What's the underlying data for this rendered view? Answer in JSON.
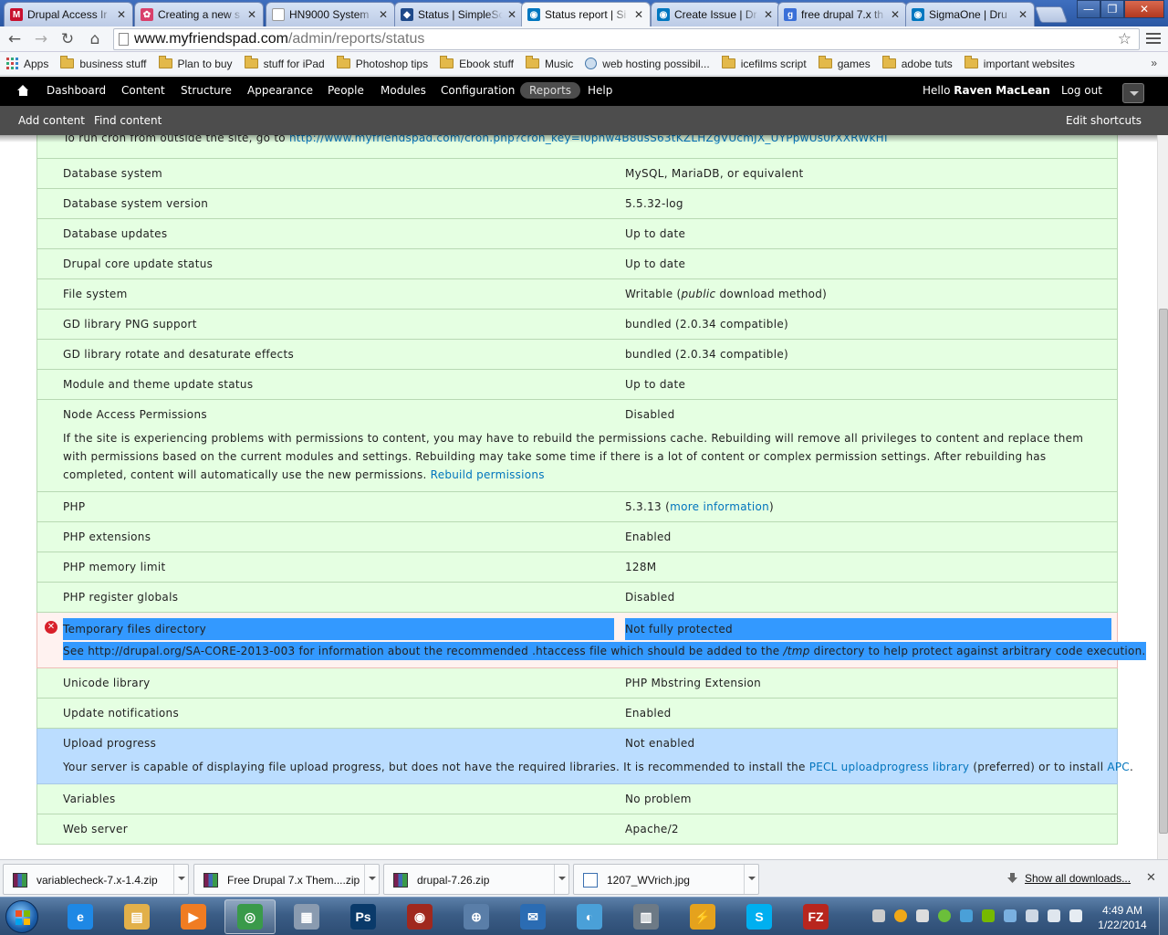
{
  "browser": {
    "tabs": [
      {
        "title": "Drupal Access Ir",
        "color": "#c8102e",
        "glyph": "M"
      },
      {
        "title": "Creating a new s",
        "color": "#d9406b",
        "glyph": "✿"
      },
      {
        "title": "HN9000 System",
        "color": "#ffffff",
        "glyph": ""
      },
      {
        "title": "Status | SimpleSc",
        "color": "#1f4a8a",
        "glyph": "◆"
      },
      {
        "title": "Status report | Si",
        "color": "#0077c0",
        "glyph": "◉",
        "active": true
      },
      {
        "title": "Create Issue | Dr",
        "color": "#0077c0",
        "glyph": "◉"
      },
      {
        "title": "free drupal 7.x th",
        "color": "#3a6fd8",
        "glyph": "g"
      },
      {
        "title": "SigmaOne | Dru",
        "color": "#0077c0",
        "glyph": "◉"
      }
    ],
    "url": {
      "host": "www.myfriendspad.com",
      "path": "/admin/reports/status"
    },
    "bookmarks": [
      {
        "label": "Apps",
        "type": "apps"
      },
      {
        "label": "business stuff",
        "type": "folder"
      },
      {
        "label": "Plan to buy",
        "type": "folder"
      },
      {
        "label": "stuff for iPad",
        "type": "folder"
      },
      {
        "label": "Photoshop tips",
        "type": "folder"
      },
      {
        "label": "Ebook stuff",
        "type": "folder"
      },
      {
        "label": "Music",
        "type": "folder"
      },
      {
        "label": "web hosting possibil...",
        "type": "page"
      },
      {
        "label": "icefilms script",
        "type": "folder"
      },
      {
        "label": "games",
        "type": "folder"
      },
      {
        "label": "adobe tuts",
        "type": "folder"
      },
      {
        "label": "important websites",
        "type": "folder"
      }
    ],
    "bookmarks_more": "»"
  },
  "drupal_toolbar": {
    "menu": [
      "Dashboard",
      "Content",
      "Structure",
      "Appearance",
      "People",
      "Modules",
      "Configuration",
      "Reports",
      "Help"
    ],
    "active": "Reports",
    "hello_prefix": "Hello",
    "user": "Raven MacLean",
    "logout": "Log out",
    "shortcuts": [
      "Add content",
      "Find content"
    ],
    "edit_shortcuts": "Edit shortcuts"
  },
  "status_report": {
    "cron_row": {
      "text": "To run cron from outside the site, go to ",
      "link": "http://www.myfriendspad.com/cron.php?cron_key=I0phw4B8usS63tKZLHZgVUcmJX_UYPpwUs0rXXRWkHI"
    },
    "rows": [
      {
        "title": "Database system",
        "value": "MySQL, MariaDB, or equivalent",
        "severity": "ok"
      },
      {
        "title": "Database system version",
        "value": "5.5.32-log",
        "severity": "ok"
      },
      {
        "title": "Database updates",
        "value": "Up to date",
        "severity": "ok"
      },
      {
        "title": "Drupal core update status",
        "value": "Up to date",
        "severity": "ok",
        "value_link": true
      },
      {
        "title": "File system",
        "value_pre": "Writable (",
        "value_em": "public",
        "value_post": " download method)",
        "severity": "ok"
      },
      {
        "title": "GD library PNG support",
        "value": "bundled (2.0.34 compatible)",
        "severity": "ok"
      },
      {
        "title": "GD library rotate and desaturate effects",
        "value": "bundled (2.0.34 compatible)",
        "severity": "ok"
      },
      {
        "title": "Module and theme update status",
        "value": "Up to date",
        "severity": "ok",
        "value_link": true
      },
      {
        "title": "Node Access Permissions",
        "value": "Disabled",
        "severity": "ok",
        "description": "If the site is experiencing problems with permissions to content, you may have to rebuild the permissions cache. Rebuilding will remove all privileges to content and replace them with permissions based on the current modules and settings. Rebuilding may take some time if there is a lot of content or complex permission settings. After rebuilding has completed, content will automatically use the new permissions. ",
        "description_link": "Rebuild permissions"
      },
      {
        "title": "PHP",
        "value_pre": "5.3.13 (",
        "value_link_text": "more information",
        "value_post": ")",
        "severity": "ok"
      },
      {
        "title": "PHP extensions",
        "value": "Enabled",
        "severity": "ok"
      },
      {
        "title": "PHP memory limit",
        "value": "128M",
        "severity": "ok"
      },
      {
        "title": "PHP register globals",
        "value": "Disabled",
        "severity": "ok"
      },
      {
        "title": "Temporary files directory",
        "value": "Not fully protected",
        "severity": "error",
        "description_pre": "See http://drupal.org/SA-CORE-2013-003 for information about the recommended .htaccess file which should be added to the ",
        "description_em": "/tmp",
        "description_post": " directory to help protect against arbitrary code execution."
      },
      {
        "title": "Unicode library",
        "value": "PHP Mbstring Extension",
        "severity": "ok"
      },
      {
        "title": "Update notifications",
        "value": "Enabled",
        "severity": "ok"
      },
      {
        "title": "Upload progress",
        "value": "Not enabled",
        "severity": "info",
        "description_pre": "Your server is capable of displaying file upload progress, but does not have the required libraries. It is recommended to install the ",
        "description_link1": "PECL uploadprogress library",
        "description_mid": " (preferred) or to install ",
        "description_link2": "APC",
        "description_post": "."
      },
      {
        "title": "Variables",
        "value": "No problem",
        "severity": "ok"
      },
      {
        "title": "Web server",
        "value": "Apache/2",
        "severity": "ok"
      }
    ],
    "colors": {
      "ok": "#e5ffe2",
      "info": "#bbddff",
      "error": "#fff2f0",
      "link": "#0074bd",
      "selection": "#3399ff"
    }
  },
  "downloads": {
    "items": [
      {
        "name": "variablecheck-7.x-1.4.zip",
        "icon": "winrar-icon"
      },
      {
        "name": "Free Drupal 7.x Them....zip",
        "icon": "winrar-icon"
      },
      {
        "name": "drupal-7.26.zip",
        "icon": "winrar-icon"
      },
      {
        "name": "1207_WVrich.jpg",
        "icon": "image-file-icon"
      }
    ],
    "show_all": "Show all downloads..."
  },
  "taskbar": {
    "apps": [
      {
        "name": "ie-icon",
        "glyph": "e",
        "color": "#1e88e5"
      },
      {
        "name": "explorer-icon",
        "glyph": "▤",
        "color": "#e2b04a"
      },
      {
        "name": "media-player-icon",
        "glyph": "▶",
        "color": "#f07c22"
      },
      {
        "name": "chrome-icon",
        "glyph": "◎",
        "color": "#3a9a4a",
        "active": true
      },
      {
        "name": "calculator-icon",
        "glyph": "▦",
        "color": "#8a9bb0"
      },
      {
        "name": "photoshop-icon",
        "glyph": "Ps",
        "color": "#0a3a6a"
      },
      {
        "name": "game-icon",
        "glyph": "◉",
        "color": "#a0281e"
      },
      {
        "name": "network-icon",
        "glyph": "⊕",
        "color": "#5a7ea8"
      },
      {
        "name": "thunderbird-icon",
        "glyph": "✉",
        "color": "#2b6cb3"
      },
      {
        "name": "audio-icon",
        "glyph": "◐",
        "color": "#4aa0d8"
      },
      {
        "name": "archive-icon",
        "glyph": "▥",
        "color": "#6d7a86"
      },
      {
        "name": "lightning-icon",
        "glyph": "⚡",
        "color": "#e5a21d"
      },
      {
        "name": "skype-icon",
        "glyph": "S",
        "color": "#00aff0"
      },
      {
        "name": "filezilla-icon",
        "glyph": "FZ",
        "color": "#b8261e"
      }
    ],
    "time": "4:49 AM",
    "date": "1/22/2014"
  }
}
